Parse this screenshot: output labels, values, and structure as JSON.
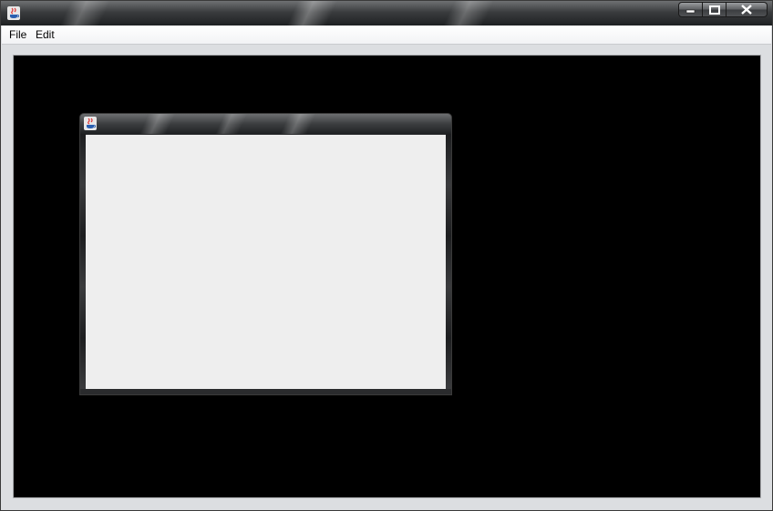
{
  "window": {
    "title": "",
    "icon": "java-coffee-cup-icon",
    "controls": {
      "minimize_icon": "minimize-icon",
      "maximize_icon": "maximize-icon",
      "close_icon": "close-icon"
    }
  },
  "menubar": {
    "items": [
      {
        "label": "File"
      },
      {
        "label": "Edit"
      }
    ]
  },
  "desktop": {
    "background": "#000000",
    "internal_frame": {
      "title": "",
      "icon": "java-coffee-cup-icon",
      "content_background": "#eeeeee"
    }
  }
}
